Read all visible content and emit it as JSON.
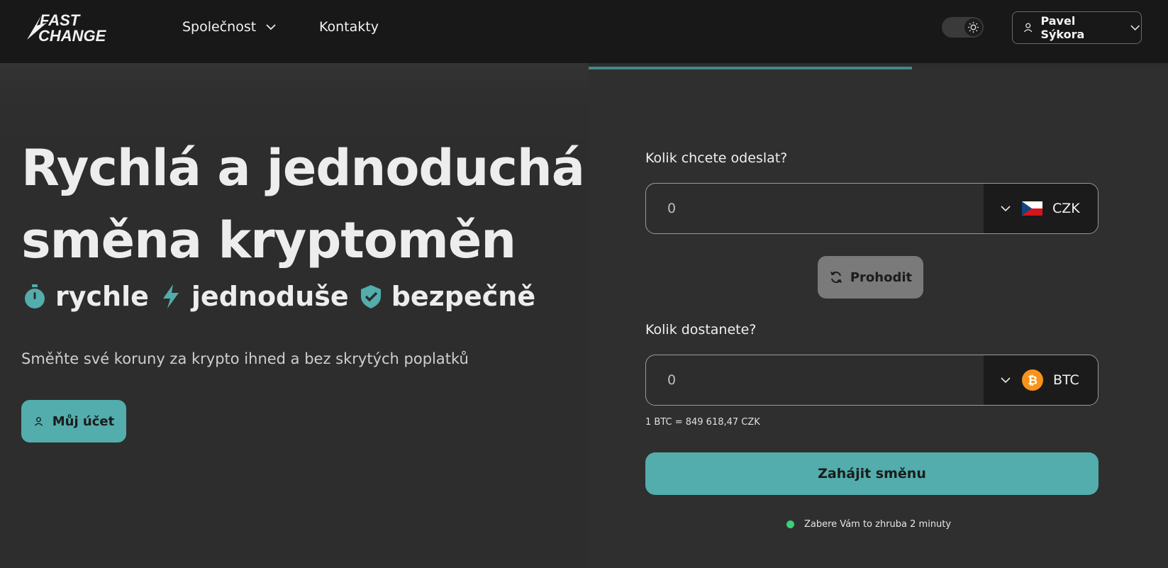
{
  "brand": {
    "logo_line1": "FAST",
    "logo_line2": "CHANGE"
  },
  "nav": {
    "company": "Společnost",
    "contacts": "Kontakty"
  },
  "theme_toggle": {
    "icon": "sun-icon"
  },
  "user": {
    "name": "Pavel Sýkora"
  },
  "hero": {
    "title_line1": "Rychlá a jednoduchá",
    "title_line2": "směna kryptoměn",
    "features": [
      {
        "label": "rychle",
        "icon": "stopwatch-icon"
      },
      {
        "label": "jednoduše",
        "icon": "lightning-icon"
      },
      {
        "label": "bezpečně",
        "icon": "shield-check-icon"
      }
    ],
    "subtitle": "Směňte své koruny za krypto ihned a bez skrytých poplatků",
    "account_button": "Můj účet"
  },
  "exchange": {
    "send_label": "Kolik chcete odeslat?",
    "send_value": "0",
    "send_currency": "CZK",
    "swap_button": "Prohodit",
    "receive_label": "Kolik dostanete?",
    "receive_value": "0",
    "receive_currency": "BTC",
    "rate": "1 BTC = 849 618,47 CZK",
    "start_button": "Zahájit směnu",
    "time_note": "Zabere Vám to zhruba 2 minuty"
  },
  "colors": {
    "accent": "#52adac",
    "header_bg": "#181818",
    "page_bg": "#2d2d2d",
    "status_dot": "#3ad07a",
    "bitcoin": "#f7931a"
  }
}
